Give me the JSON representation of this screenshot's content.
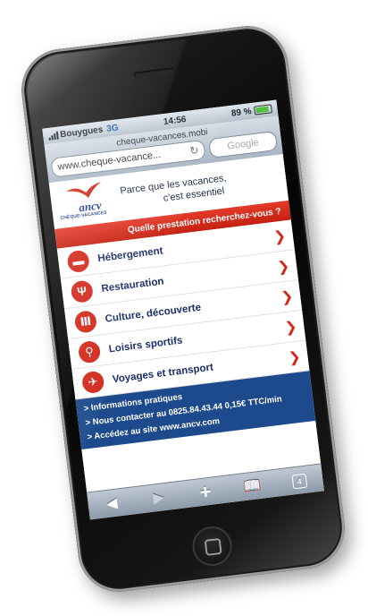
{
  "status_bar": {
    "carrier": "Bouygues",
    "network": "3G",
    "time": "14:56",
    "battery": "89 %"
  },
  "browser": {
    "page_title": "cheque-vacances.mobi",
    "url": "www.cheque-vacance...",
    "search_placeholder": "Google"
  },
  "header": {
    "logo_word": "ancv",
    "logo_sub": "CHÈQUE-VACANCES",
    "tagline_line1": "Parce que les vacances,",
    "tagline_line2": "c'est essentiel"
  },
  "banner": {
    "text": "Quelle prestation recherchez-vous ?"
  },
  "menu": {
    "items": [
      {
        "label": "Hébergement",
        "icon": "bed-icon"
      },
      {
        "label": "Restauration",
        "icon": "fork-knife-icon"
      },
      {
        "label": "Culture, découverte",
        "icon": "museum-icon"
      },
      {
        "label": "Loisirs sportifs",
        "icon": "bicycle-icon"
      },
      {
        "label": "Voyages et transport",
        "icon": "airplane-icon"
      }
    ]
  },
  "links": {
    "infos": "> Informations pratiques",
    "contact": "> Nous contacter au 0825.84.43.44 0,15€ TTC/min",
    "site": "> Accédez au site www.ancv.com"
  },
  "toolbar": {
    "tabs_count": "4"
  },
  "colors": {
    "brand_red": "#d2281a",
    "brand_blue": "#1c4a8c"
  }
}
